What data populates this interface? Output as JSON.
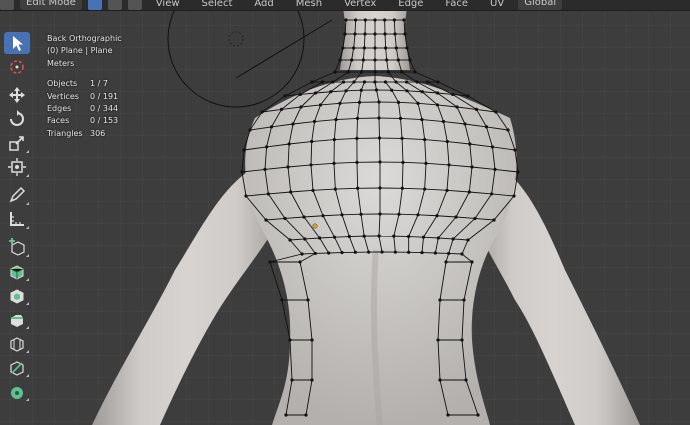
{
  "header": {
    "mode_label": "Edit Mode",
    "menus": [
      "View",
      "Select",
      "Add",
      "Mesh",
      "Vertex",
      "Edge",
      "Face",
      "UV"
    ],
    "transform_label": "Global"
  },
  "viewport": {
    "view_name": "Back Orthographic",
    "object_info": "(0) Plane | Plane",
    "units": "Meters"
  },
  "stats": {
    "objects_label": "Objects",
    "objects_value": "1 / 7",
    "vertices_label": "Vertices",
    "vertices_value": "0 / 191",
    "edges_label": "Edges",
    "edges_value": "0 / 344",
    "faces_label": "Faces",
    "faces_value": "0 / 153",
    "triangles_label": "Triangles",
    "triangles_value": "306"
  },
  "colors": {
    "viewport_bg": "#3d3d3d",
    "grid": "#4a4a4a",
    "accent": "#4772b3",
    "mesh_edge": "#000000",
    "skin": "#c9c6c3",
    "origin_dot": "#f0a020"
  },
  "tools": [
    {
      "name": "select-box-tool",
      "icon": "cursor-icon",
      "active": true
    },
    {
      "name": "cursor-tool",
      "icon": "crosshair-icon",
      "active": false
    },
    {
      "name": "move-tool",
      "icon": "move-arrows-icon",
      "active": false
    },
    {
      "name": "rotate-tool",
      "icon": "rotate-icon",
      "active": false
    },
    {
      "name": "scale-tool",
      "icon": "scale-icon",
      "active": false
    },
    {
      "name": "transform-tool",
      "icon": "transform-icon",
      "active": false
    },
    {
      "name": "annotate-tool",
      "icon": "pencil-icon",
      "active": false
    },
    {
      "name": "measure-tool",
      "icon": "ruler-icon",
      "active": false
    },
    {
      "name": "add-cube-tool",
      "icon": "add-cube-icon",
      "active": false
    },
    {
      "name": "extrude-tool",
      "icon": "extrude-icon",
      "active": false
    },
    {
      "name": "inset-tool",
      "icon": "inset-icon",
      "active": false
    },
    {
      "name": "bevel-tool",
      "icon": "bevel-icon",
      "active": false
    },
    {
      "name": "loop-cut-tool",
      "icon": "loop-cut-icon",
      "active": false
    },
    {
      "name": "knife-tool",
      "icon": "knife-icon",
      "active": false
    },
    {
      "name": "poly-build-tool",
      "icon": "poly-build-icon",
      "active": false
    }
  ]
}
